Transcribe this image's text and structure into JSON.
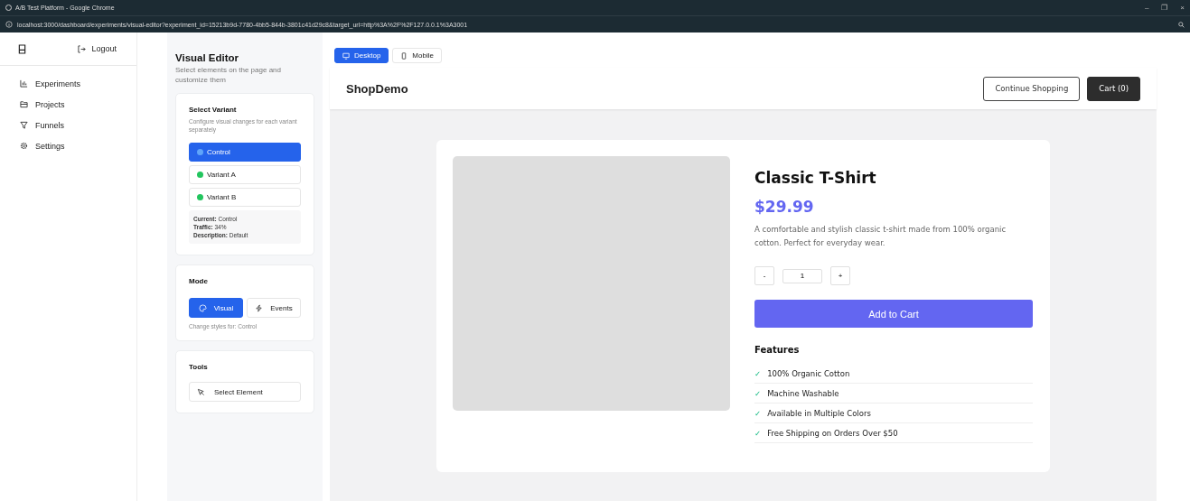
{
  "window": {
    "title": "A/B Test Platform - Google Chrome",
    "url": "localhost:3000/dashboard/experiments/visual-editor?experiment_id=15213b9d-7780-4bb5-844b-3801c41d29c8&target_url=http%3A%2F%2F127.0.0.1%3A3001",
    "controls": [
      "–",
      "❐",
      "×"
    ]
  },
  "sidebar": {
    "logout": "Logout",
    "items": [
      {
        "label": "Experiments",
        "kind": "chart",
        "selected": false
      },
      {
        "label": "Projects",
        "kind": "folder",
        "selected": false
      },
      {
        "label": "Funnels",
        "kind": "funnel",
        "selected": false
      },
      {
        "label": "Settings",
        "kind": "gear",
        "selected": false
      }
    ]
  },
  "editor": {
    "title": "Visual Editor",
    "subtitle": "Select elements on the page and customize them",
    "variant_card": {
      "title": "Select Variant",
      "subtitle": "Configure visual changes for each variant separately",
      "variants": [
        {
          "label": "Control",
          "selected": true,
          "color": "#60a5fa"
        },
        {
          "label": "Variant A",
          "selected": false,
          "color": "#22c55e"
        },
        {
          "label": "Variant B",
          "selected": false,
          "color": "#22c55e"
        }
      ],
      "info": [
        {
          "key": "Current:",
          "value": "Control"
        },
        {
          "key": "Traffic:",
          "value": "34%"
        },
        {
          "key": "Description:",
          "value": "Default"
        }
      ]
    },
    "mode_card": {
      "title": "Mode",
      "modes": [
        {
          "label": "Visual",
          "kind": "palette",
          "selected": true
        },
        {
          "label": "Events",
          "kind": "bolt",
          "selected": false
        }
      ],
      "hint": "Change styles for: Control"
    },
    "tools_card": {
      "title": "Tools",
      "tools": [
        {
          "label": "Select Element"
        }
      ]
    }
  },
  "preview": {
    "views": [
      {
        "label": "Desktop",
        "kind": "monitor",
        "selected": true
      },
      {
        "label": "Mobile",
        "kind": "phone",
        "selected": false
      }
    ],
    "shop": {
      "brand": "ShopDemo",
      "buttons": [
        {
          "label": "Continue Shopping",
          "kind": "outline"
        },
        {
          "label": "Cart (0)",
          "kind": "dark"
        }
      ],
      "product": {
        "kind": "picture",
        "name": "Classic T-Shirt",
        "price": "$29.99",
        "description": "A comfortable and stylish classic t-shirt made from 100% organic cotton. Perfect for everyday wear.",
        "minus": "-",
        "quantity": "1",
        "plus": "+",
        "add_button": "Add to Cart",
        "features_title": "Features",
        "check": "✓",
        "features": [
          "100% Organic Cotton",
          "Machine Washable",
          "Available in Multiple Colors",
          "Free Shipping on Orders Over $50"
        ]
      }
    }
  }
}
